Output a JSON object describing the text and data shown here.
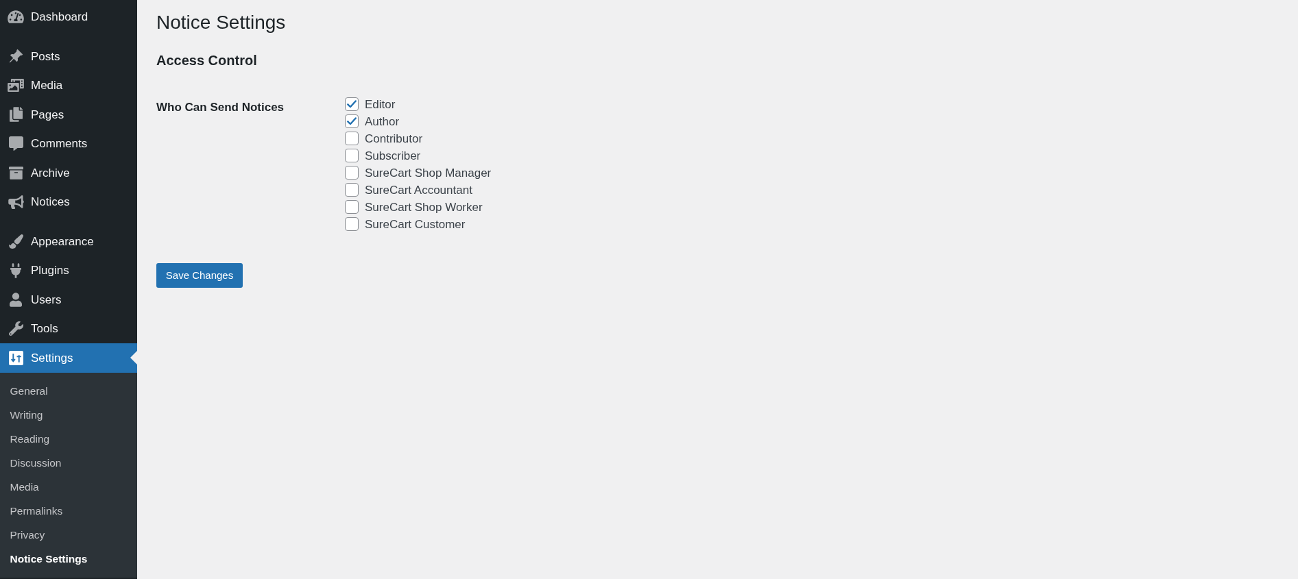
{
  "sidebar": {
    "groups": [
      {
        "items": [
          {
            "label": "Dashboard",
            "selected": false
          }
        ]
      },
      {
        "items": [
          {
            "label": "Posts",
            "selected": false
          },
          {
            "label": "Media",
            "selected": false
          },
          {
            "label": "Pages",
            "selected": false
          },
          {
            "label": "Comments",
            "selected": false
          },
          {
            "label": "Archive",
            "selected": false
          },
          {
            "label": "Notices",
            "selected": false
          }
        ]
      },
      {
        "items": [
          {
            "label": "Appearance",
            "selected": false
          },
          {
            "label": "Plugins",
            "selected": false
          },
          {
            "label": "Users",
            "selected": false
          },
          {
            "label": "Tools",
            "selected": false
          },
          {
            "label": "Settings",
            "selected": true,
            "children": [
              {
                "label": "General",
                "selected": false
              },
              {
                "label": "Writing",
                "selected": false
              },
              {
                "label": "Reading",
                "selected": false
              },
              {
                "label": "Discussion",
                "selected": false
              },
              {
                "label": "Media",
                "selected": false
              },
              {
                "label": "Permalinks",
                "selected": false
              },
              {
                "label": "Privacy",
                "selected": false
              },
              {
                "label": "Notice Settings",
                "selected": true
              }
            ]
          }
        ]
      }
    ]
  },
  "main": {
    "title": "Notice Settings",
    "section_title": "Access Control",
    "field": {
      "label": "Who Can Send Notices",
      "options": [
        {
          "label": "Editor",
          "checked": true
        },
        {
          "label": "Author",
          "checked": true
        },
        {
          "label": "Contributor",
          "checked": false
        },
        {
          "label": "Subscriber",
          "checked": false
        },
        {
          "label": "SureCart Shop Manager",
          "checked": false
        },
        {
          "label": "SureCart Accountant",
          "checked": false
        },
        {
          "label": "SureCart Shop Worker",
          "checked": false
        },
        {
          "label": "SureCart Customer",
          "checked": false
        }
      ]
    },
    "save_button": "Save Changes"
  }
}
